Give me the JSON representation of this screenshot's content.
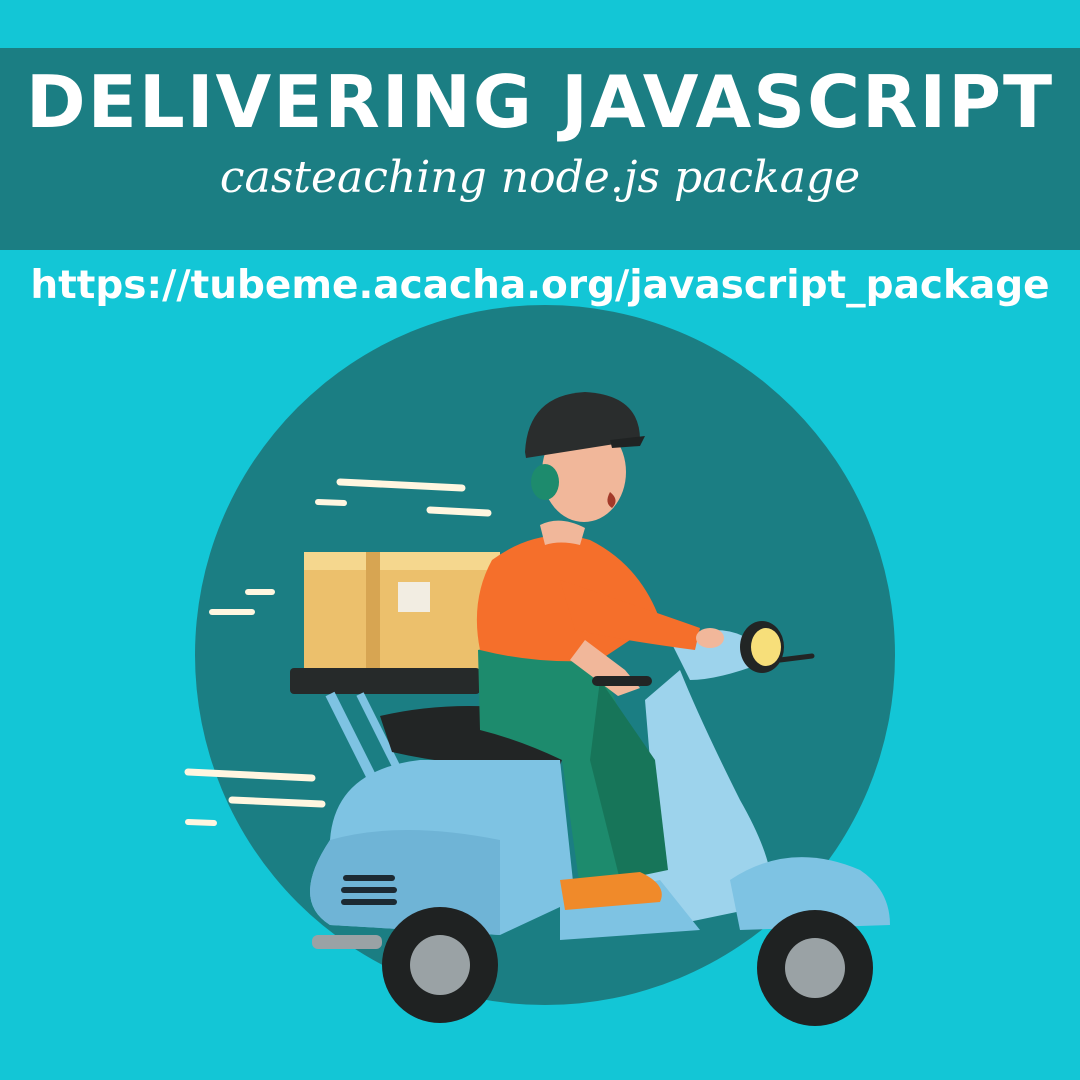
{
  "header": {
    "title": "DELIVERING JAVASCRIPT",
    "subtitle": "casteaching node.js package"
  },
  "link": {
    "url": "https://tubeme.acacha.org/javascript_package"
  },
  "illustration": {
    "subject": "delivery-rider-on-scooter",
    "icons": [
      "helmet-icon",
      "package-box-icon",
      "scooter-icon",
      "motion-lines-icon"
    ]
  },
  "colors": {
    "background": "#13c6d6",
    "banner": "#1b7e83",
    "circle": "#1b7e83",
    "text": "#ffffff",
    "shirt": "#f56f2b",
    "pants": "#1d8b6d",
    "scooter": "#7ec3e3",
    "box": "#ecc06c",
    "helmet": "#2a2d2d"
  }
}
